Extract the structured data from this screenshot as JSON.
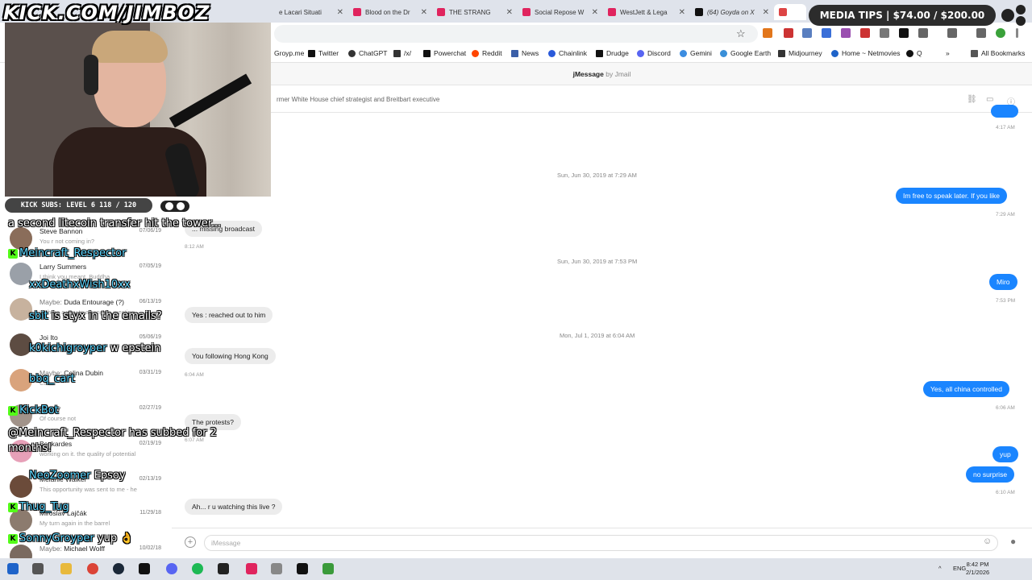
{
  "browser": {
    "tabs": [
      {
        "title": "e Lacari Situati",
        "color": "#888888"
      },
      {
        "title": "Blood on the Dr",
        "color": "#e0245e"
      },
      {
        "title": "THE STRANG",
        "color": "#e0245e"
      },
      {
        "title": "Social Repose W",
        "color": "#e0245e"
      },
      {
        "title": "WestJett & Lega",
        "color": "#e0245e"
      },
      {
        "title": "(64) Goyda on X",
        "color": "#111111"
      }
    ],
    "bookmarks": [
      {
        "label": "Groyp.me",
        "color": "#6a8f3a"
      },
      {
        "label": "Twitter",
        "color": "#111111"
      },
      {
        "label": "ChatGPT",
        "color": "#333333"
      },
      {
        "label": "/x/",
        "color": "#333333"
      },
      {
        "label": "Powerchat",
        "color": "#111111"
      },
      {
        "label": "Reddit",
        "color": "#ff4500"
      },
      {
        "label": "News",
        "color": "#3b5fa8"
      },
      {
        "label": "Chainlink",
        "color": "#2a5ada"
      },
      {
        "label": "Drudge",
        "color": "#111111"
      },
      {
        "label": "Discord",
        "color": "#5865f2"
      },
      {
        "label": "Gemini",
        "color": "#3c8de0"
      },
      {
        "label": "Google Earth",
        "color": "#3a8fd8"
      },
      {
        "label": "Midjourney",
        "color": "#333333"
      },
      {
        "label": "Home ~ Netmovies",
        "color": "#1e63c9"
      },
      {
        "label": "Q",
        "color": "#111111"
      }
    ],
    "more_bookmarks": "»",
    "all_bookmarks": "All Bookmarks"
  },
  "app": {
    "title": "jMessage",
    "by": "by Jmail",
    "conversation_subtitle": "rmer White House chief strategist and Breitbart executive"
  },
  "messages": {
    "top_time": "4:17 AM",
    "items": [
      {
        "kind": "stamp",
        "text": "Sun, Jun 30, 2019 at 7:29 AM"
      },
      {
        "kind": "out",
        "text": "Im free to speak later. If you like",
        "time": "7:29 AM"
      },
      {
        "kind": "in",
        "text": "... missing broadcast",
        "time": "8:12 AM"
      },
      {
        "kind": "stamp",
        "text": "Sun, Jun 30, 2019 at 7:53 PM"
      },
      {
        "kind": "out",
        "text": "Miro",
        "time": "7:53 PM"
      },
      {
        "kind": "in",
        "text": "Yes : reached out to him"
      },
      {
        "kind": "stamp",
        "text": "Mon, Jul 1, 2019 at 6:04 AM"
      },
      {
        "kind": "in",
        "text": "You following Hong Kong",
        "time": "6:04 AM"
      },
      {
        "kind": "out",
        "text": "Yes, all china controlled",
        "time": "6:06 AM"
      },
      {
        "kind": "in",
        "text": "The protests?",
        "time": "6:07 AM"
      },
      {
        "kind": "out",
        "text": "yup"
      },
      {
        "kind": "out",
        "text": "no surprise",
        "time": "6:10 AM"
      },
      {
        "kind": "in",
        "text": "Ah... r u watching this live ?"
      }
    ]
  },
  "composer": {
    "placeholder": "iMessage",
    "plus": "+",
    "emoji": "☺",
    "mic": "🎙"
  },
  "contacts": [
    {
      "name": "Steve Bannon",
      "maybe": "",
      "preview": "You r not coming in?",
      "date": "07/06/19",
      "color": "#8a6d5a"
    },
    {
      "name": "Larry Summers",
      "maybe": "",
      "preview": "I think you meant, Buddha",
      "date": "07/05/19",
      "color": "#9aa0a8"
    },
    {
      "name": "Duda Entourage (?)",
      "maybe": "Maybe: ",
      "preview": "Is there a way to arrange a meeting",
      "date": "06/13/19",
      "color": "#c7b29e"
    },
    {
      "name": "Joi Ito",
      "maybe": "",
      "preview": "7:00 on the 6th",
      "date": "05/06/19",
      "color": "#5d4c42"
    },
    {
      "name": "Celina Dubin",
      "maybe": "Maybe: ",
      "preview": "Call",
      "date": "03/31/19",
      "color": "#d9a37c"
    },
    {
      "name": "Stacey",
      "maybe": "",
      "preview": "Of course not",
      "date": "02/27/19",
      "color": "#a1938a"
    },
    {
      "name": "Beskardes",
      "maybe": "",
      "preview": "working on it. the quality of potential",
      "date": "02/19/19",
      "color": "#e7a0b8"
    },
    {
      "name": "Melanie Walker",
      "maybe": "",
      "preview": "This opportunity was sent to me - he",
      "date": "02/13/19",
      "color": "#6b4b3a"
    },
    {
      "name": "Miroslav Lajčák",
      "maybe": "",
      "preview": "My turn again in the barrel",
      "date": "11/29/18",
      "color": "#8c7b6e"
    },
    {
      "name": "Michael Wolff",
      "maybe": "Maybe: ",
      "preview": "",
      "date": "10/02/18",
      "color": "#7a6a60"
    }
  ],
  "overlay": {
    "watermark": "KICK.COM/JIMBOZ",
    "sub_goal": "KICK SUBS: LEVEL 6 118 / 120",
    "media_tips": "MEDIA TIPS | $74.00 / $200.00",
    "chat": [
      {
        "user": "",
        "msg": "a second litecoin transfer hit the tower..."
      },
      {
        "user": "Meincraft_Respector",
        "msg": ""
      },
      {
        "user": "xxDeathxWish10xx",
        "msg": ""
      },
      {
        "user": "sbit",
        "msg": "is styx in the emails?"
      },
      {
        "user": "k0kichigroyper",
        "msg": "w epstein"
      },
      {
        "user": "bbq_cart",
        "msg": ""
      },
      {
        "user": "KickBot",
        "msg": ""
      },
      {
        "user": "",
        "msg": "@Meincraft_Respector has subbed for 2 months!"
      },
      {
        "user": "NeoZoomer",
        "msg": "Epsoy"
      },
      {
        "user": "Thug_Tug",
        "msg": ""
      },
      {
        "user": "SonnyGroyper",
        "msg": "yup 👌"
      }
    ]
  },
  "taskbar": {
    "lang": "ENG",
    "time": "8:42 PM",
    "date": "2/1/2026"
  }
}
